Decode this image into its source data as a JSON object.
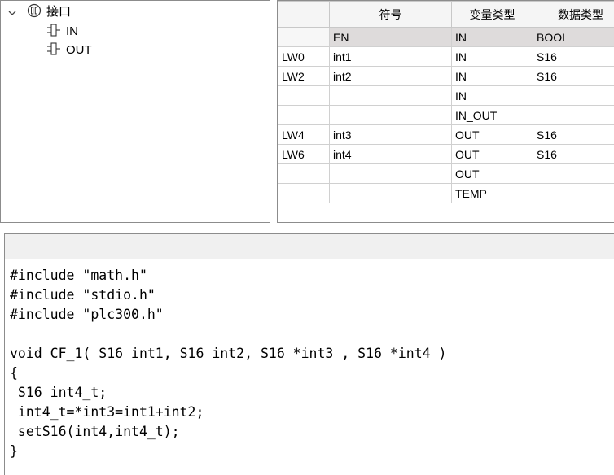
{
  "tree": {
    "root_label": "接口",
    "children": [
      {
        "label": "IN"
      },
      {
        "label": "OUT"
      }
    ]
  },
  "table": {
    "headers": [
      "",
      "符号",
      "变量类型",
      "数据类型"
    ],
    "rows": [
      {
        "addr": "",
        "symbol": "EN",
        "var_type": "IN",
        "data_type": "BOOL"
      },
      {
        "addr": "LW0",
        "symbol": "int1",
        "var_type": "IN",
        "data_type": "S16"
      },
      {
        "addr": "LW2",
        "symbol": "int2",
        "var_type": "IN",
        "data_type": "S16"
      },
      {
        "addr": "",
        "symbol": "",
        "var_type": "IN",
        "data_type": ""
      },
      {
        "addr": "",
        "symbol": "",
        "var_type": "IN_OUT",
        "data_type": ""
      },
      {
        "addr": "LW4",
        "symbol": "int3",
        "var_type": "OUT",
        "data_type": "S16"
      },
      {
        "addr": "LW6",
        "symbol": "int4",
        "var_type": "OUT",
        "data_type": "S16"
      },
      {
        "addr": "",
        "symbol": "",
        "var_type": "OUT",
        "data_type": ""
      },
      {
        "addr": "",
        "symbol": "",
        "var_type": "TEMP",
        "data_type": ""
      }
    ]
  },
  "code": {
    "lines": [
      "#include \"math.h\"",
      "#include \"stdio.h\"",
      "#include \"plc300.h\"",
      "",
      "void CF_1( S16 int1, S16 int2, S16 *int3 , S16 *int4 )",
      "{",
      " S16 int4_t;",
      " int4_t=*int3=int1+int2;",
      " setS16(int4,int4_t);",
      "}"
    ]
  },
  "icons": {
    "tree_root": "interface-icon",
    "tree_child": "pin-icon",
    "expand": "chevron-down-icon"
  },
  "colors": {
    "en_row_background": "#dedbdb",
    "header_background": "#f5f5f5",
    "border": "#8c8c8c"
  }
}
